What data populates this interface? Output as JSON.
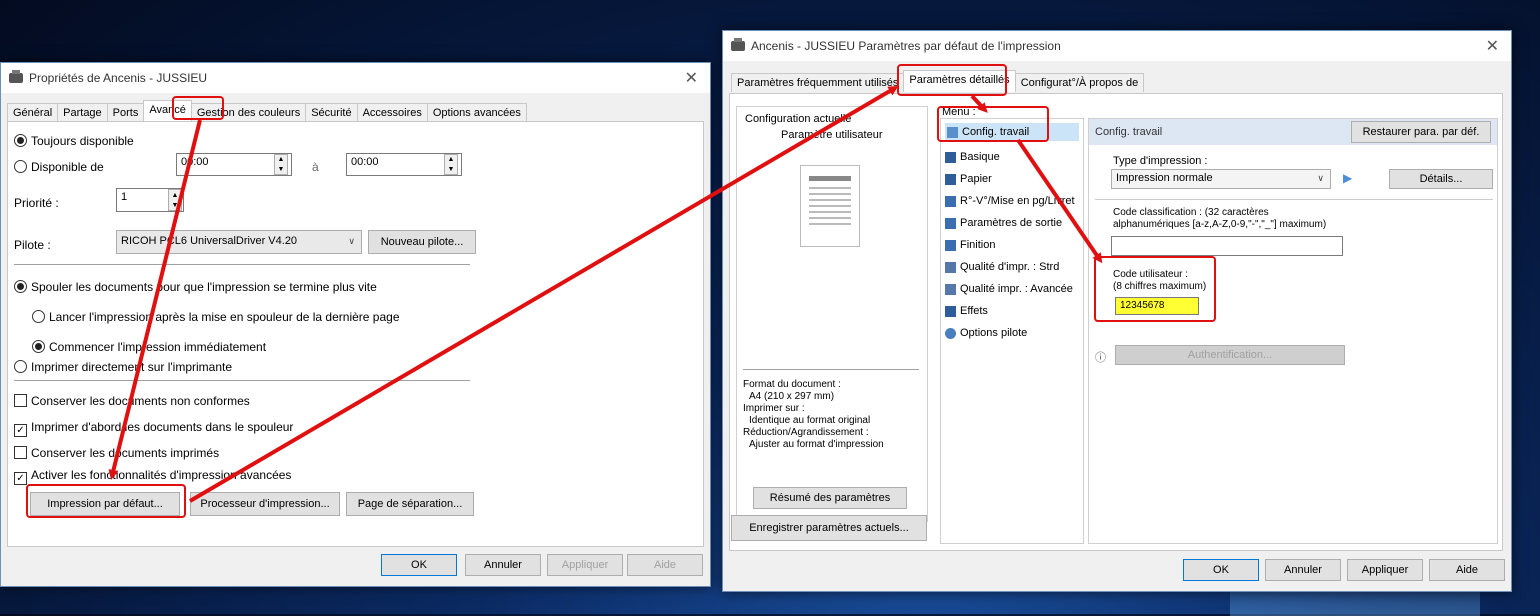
{
  "left_window": {
    "title": "Propriétés de Ancenis - JUSSIEU",
    "tabs": [
      "Général",
      "Partage",
      "Ports",
      "Avancé",
      "Gestion des couleurs",
      "Sécurité",
      "Accessoires",
      "Options avancées"
    ],
    "availability": {
      "always": "Toujours disponible",
      "from": "Disponible de",
      "from_time": "00:00",
      "to_label": "à",
      "to_time": "00:00"
    },
    "priority": {
      "label": "Priorité :",
      "value": "1"
    },
    "driver": {
      "label": "Pilote :",
      "value": "RICOH PCL6 UniversalDriver V4.20",
      "new_button": "Nouveau pilote..."
    },
    "spool": {
      "spool_label": "Spouler les documents pour que l'impression se termine plus vite",
      "after_last": "Lancer l'impression après la mise en spouleur de la dernière page",
      "immediate": "Commencer l'impression immédiatement",
      "direct": "Imprimer directement sur l'imprimante"
    },
    "checks": {
      "hold": "Conserver les documents non conformes",
      "first": "Imprimer d'abord les documents dans le spouleur",
      "keep": "Conserver les documents imprimés",
      "advanced": "Activer les fonctionnalités d'impression avancées"
    },
    "buttons": {
      "defaults": "Impression par défaut...",
      "processor": "Processeur d'impression...",
      "separator": "Page de séparation..."
    },
    "footer": {
      "ok": "OK",
      "cancel": "Annuler",
      "apply": "Appliquer",
      "help": "Aide"
    }
  },
  "right_window": {
    "title": "Ancenis - JUSSIEU Paramètres par défaut de l'impression",
    "tabs": [
      "Paramètres fréquemment utilisés",
      "Paramètres détaillés",
      "Configurat°/À propos de"
    ],
    "current_config": {
      "label": "Configuration actuelle",
      "user": "Paramètre utilisateur"
    },
    "doc_info": {
      "format_label": "Format du document :",
      "format_value": "A4 (210 x 297 mm)",
      "print_on_label": "Imprimer sur :",
      "print_on_value": "Identique au format original",
      "reduce_label": "Réduction/Agrandissement :",
      "reduce_value": "Ajuster au format d'impression"
    },
    "summary_button": "Résumé des paramètres",
    "save_button": "Enregistrer paramètres actuels...",
    "menu_label": "Menu :",
    "menu": [
      "Config. travail",
      "Basique",
      "Papier",
      "R°-V°/Mise en pg/Livret",
      "Paramètres de sortie",
      "Finition",
      "Qualité d'impr. : Strd",
      "Qualité impr. : Avancée",
      "Effets",
      "Options pilote"
    ],
    "job": {
      "header": "Config. travail",
      "restore": "Restaurer para. par déf.",
      "type_label": "Type d'impression :",
      "type_value": "Impression normale",
      "details": "Détails...",
      "class_label": "Code classification : (32 caractères",
      "class_label2": "alphanumériques [a-z,A-Z,0-9,\"-\",\"_\"] maximum)",
      "class_value": "",
      "user_label": "Code utilisateur :",
      "user_hint": "(8 chiffres maximum)",
      "user_value": "12345678",
      "auth": "Authentification..."
    },
    "footer": {
      "ok": "OK",
      "cancel": "Annuler",
      "apply": "Appliquer",
      "help": "Aide"
    }
  }
}
